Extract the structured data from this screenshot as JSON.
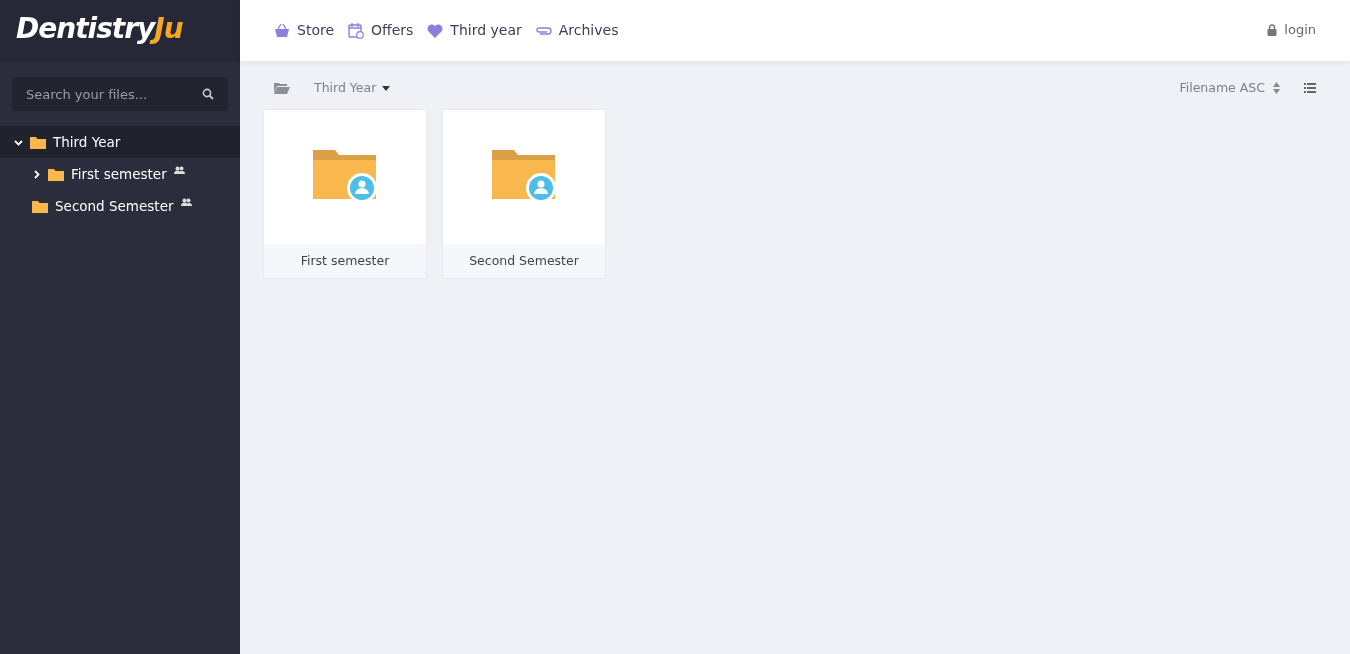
{
  "logo": {
    "main": "Dentistry",
    "accent": "Ju"
  },
  "search": {
    "placeholder": "Search your files..."
  },
  "tree": [
    {
      "label": "Third Year",
      "selected": true,
      "expanded": true,
      "children": [
        {
          "label": "First semester",
          "selected": false,
          "expanded": false,
          "shared": true
        },
        {
          "label": "Second Semester",
          "selected": false,
          "shared": true
        }
      ]
    }
  ],
  "nav": [
    {
      "label": "Store"
    },
    {
      "label": "Offers"
    },
    {
      "label": "Third year"
    },
    {
      "label": "Archives"
    }
  ],
  "login": "login",
  "toolbar": {
    "folder": "Third Year",
    "sort": "Filename ASC"
  },
  "folders": [
    {
      "name": "First semester",
      "shared": true
    },
    {
      "name": "Second Semester",
      "shared": true
    }
  ]
}
